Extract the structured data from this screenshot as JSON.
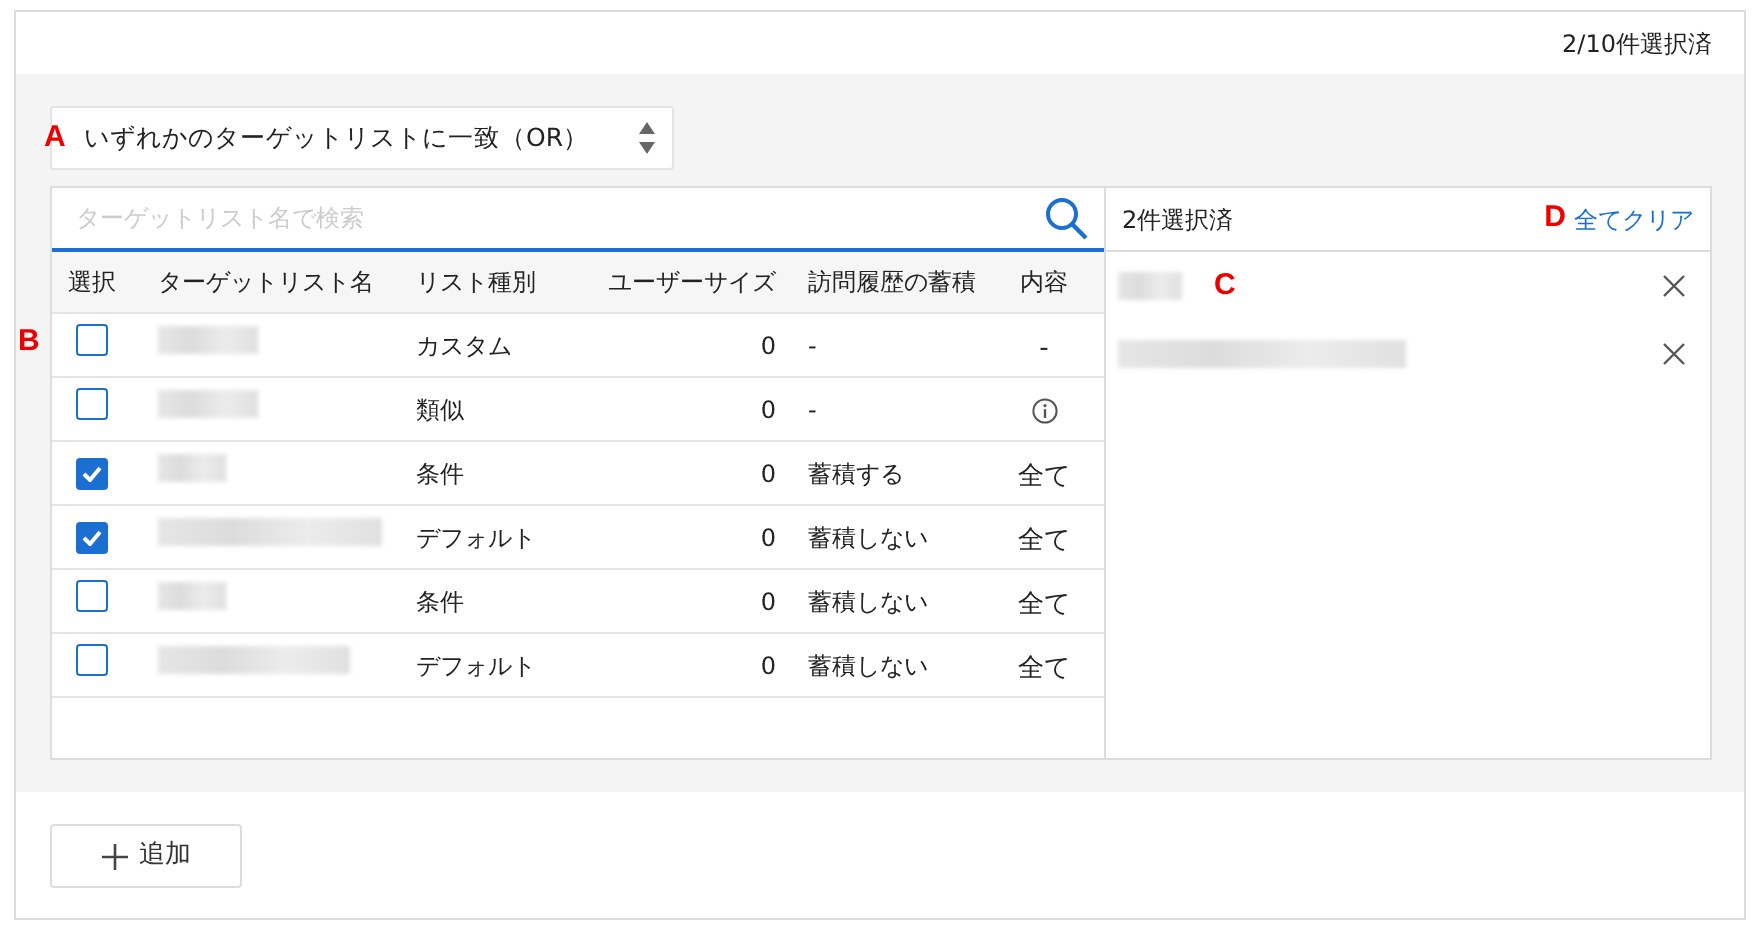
{
  "header": {
    "selection_count": "2/10件選択済"
  },
  "match_select": {
    "annotation": "A",
    "value": "いずれかのターゲットリストに一致（OR）"
  },
  "search": {
    "placeholder": "ターゲットリスト名で検索"
  },
  "table": {
    "annotation": "B",
    "columns": [
      "選択",
      "ターゲットリスト名",
      "リスト種別",
      "ユーザーサイズ",
      "訪問履歴の蓄積",
      "内容"
    ],
    "rows": [
      {
        "checked": false,
        "type": "カスタム",
        "size": "0",
        "history": "-",
        "content": {
          "kind": "text",
          "text": "-"
        }
      },
      {
        "checked": false,
        "type": "類似",
        "size": "0",
        "history": "-",
        "content": {
          "kind": "info"
        }
      },
      {
        "checked": true,
        "type": "条件",
        "size": "0",
        "history": "蓄積する",
        "content": {
          "kind": "text",
          "text": "全て"
        }
      },
      {
        "checked": true,
        "type": "デフォルト",
        "size": "0",
        "history": "蓄積しない",
        "content": {
          "kind": "text",
          "text": "全て"
        }
      },
      {
        "checked": false,
        "type": "条件",
        "size": "0",
        "history": "蓄積しない",
        "content": {
          "kind": "text",
          "text": "全て"
        }
      },
      {
        "checked": false,
        "type": "デフォルト",
        "size": "0",
        "history": "蓄積しない",
        "content": {
          "kind": "text",
          "text": "全て"
        }
      }
    ]
  },
  "selected_panel": {
    "title": "2件選択済",
    "clear_annotation": "D",
    "clear_label": "全てクリア",
    "items": [
      {
        "kind": "redacted",
        "annotation": "C"
      },
      {
        "kind": "redacted"
      }
    ]
  },
  "add_button": {
    "label": "追加"
  }
}
